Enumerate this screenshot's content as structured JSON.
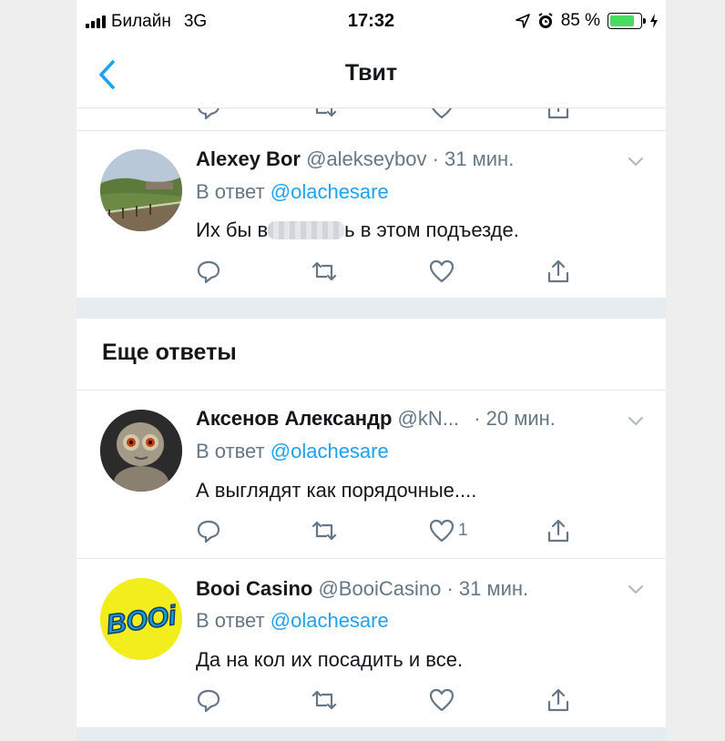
{
  "status_bar": {
    "carrier": "Билайн",
    "network": "3G",
    "time": "17:32",
    "battery_text": "85 %",
    "battery_level": 0.85,
    "icons": [
      "signal-icon",
      "location-icon",
      "alarm-icon",
      "battery-icon",
      "charging-icon"
    ]
  },
  "nav": {
    "title": "Твит",
    "back_icon": "chevron-left-icon"
  },
  "colors": {
    "accent": "#1da1f2",
    "muted": "#657786",
    "text": "#14171a",
    "separator": "#e6ecf0",
    "battery": "#4cd964"
  },
  "tweets": [
    {
      "name": "Alexey Bor",
      "handle": "@alekseybov",
      "time": "· 31 мин.",
      "reply_prefix": "В ответ",
      "reply_to": "@olachesare",
      "text_before": "Их бы в",
      "text_after": "ь в этом подъезде.",
      "likes": ""
    },
    {
      "name": "Аксенов Александр",
      "handle": "@kN...",
      "time": "· 20 мин.",
      "reply_prefix": "В ответ",
      "reply_to": "@olachesare",
      "text": "А выглядят как порядочные....",
      "likes": "1"
    },
    {
      "name": "Booi Casino",
      "handle": "@BooiCasino",
      "time": "· 31 мин.",
      "reply_prefix": "В ответ",
      "reply_to": "@olachesare",
      "text": "Да на кол их посадить и все.",
      "likes": ""
    }
  ],
  "section": {
    "more_replies": "Еще ответы"
  },
  "booi_logo_text": "BOOi"
}
